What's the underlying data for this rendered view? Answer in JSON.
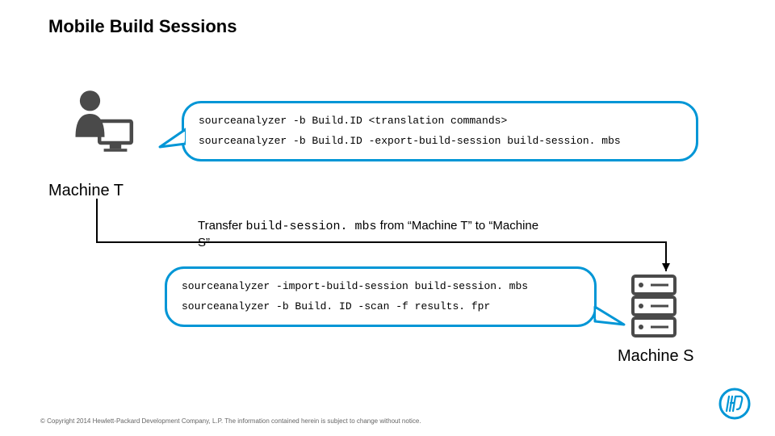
{
  "title": "Mobile Build Sessions",
  "machine_t_label": "Machine T",
  "machine_s_label": "Machine S",
  "bubble1": {
    "line1": "sourceanalyzer -b Build.ID <translation commands>",
    "line2": "sourceanalyzer -b Build.ID -export-build-session build-session. mbs"
  },
  "transfer": {
    "part1": "Transfer ",
    "file": "build-session. mbs",
    "part2": " from  “Machine T”  to “Machine S”"
  },
  "bubble2": {
    "line1": "sourceanalyzer -import-build-session build-session. mbs",
    "line2": "sourceanalyzer -b Build. ID -scan -f results. fpr"
  },
  "footer": "© Copyright 2014 Hewlett-Packard Development Company, L.P.  The information contained herein is subject to change without notice.",
  "colors": {
    "accent": "#0096d6",
    "icon_gray": "#4a4a4a"
  }
}
